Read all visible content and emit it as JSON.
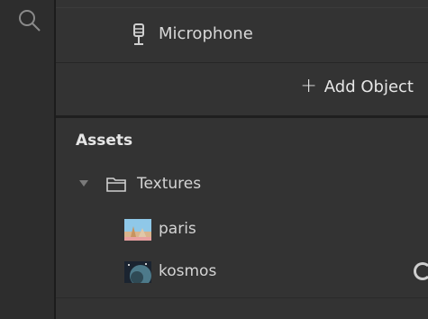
{
  "header": {
    "microphone_label": "Microphone",
    "add_object_label": "Add Object"
  },
  "assets": {
    "title": "Assets",
    "folders": [
      {
        "label": "Textures",
        "expanded": true,
        "items": [
          {
            "label": "paris",
            "icon": "image-thumbnail-icon"
          },
          {
            "label": "kosmos",
            "icon": "image-thumbnail-icon"
          }
        ]
      }
    ]
  },
  "colors": {
    "panel_bg": "#333333",
    "rail_bg": "#2d2d2d",
    "text": "#dcdcdc"
  },
  "icons": {
    "search": "search-icon",
    "microphone": "microphone-icon",
    "add": "plus-icon",
    "folder": "folder-icon",
    "expand": "caret-down-icon",
    "loading": "loading-spinner-icon"
  }
}
